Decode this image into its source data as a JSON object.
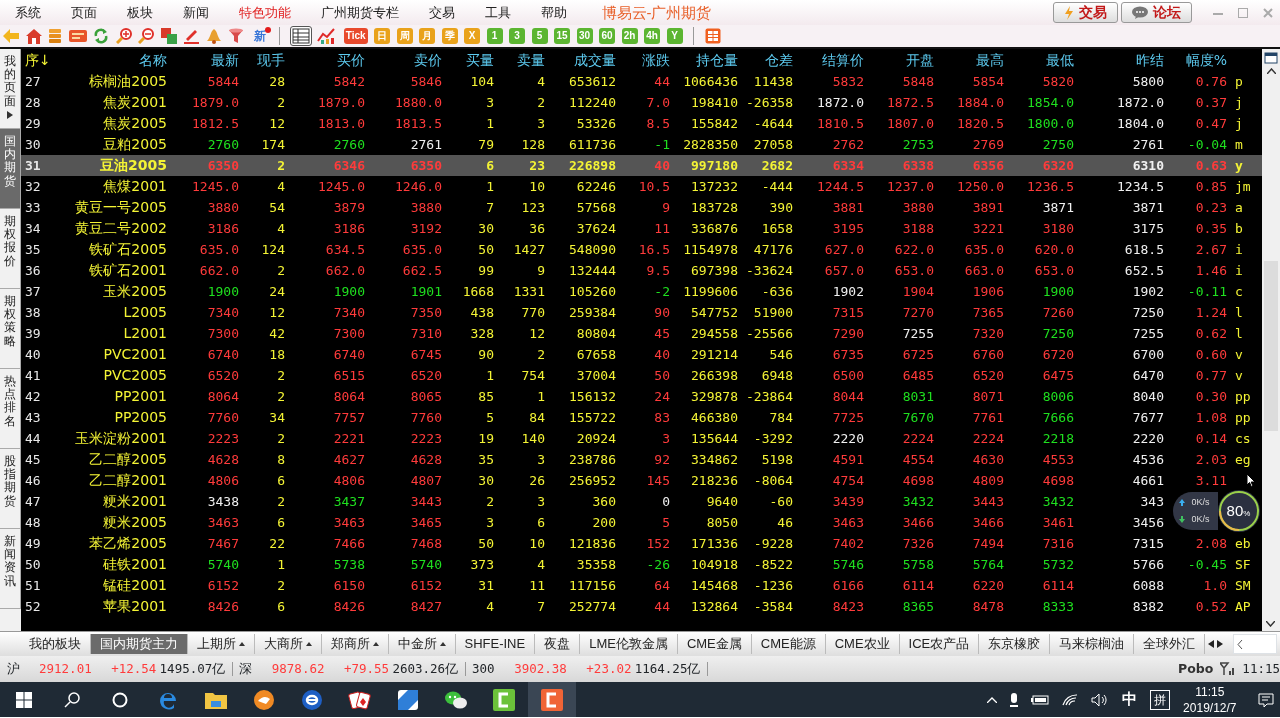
{
  "menu": [
    {
      "label": "系统",
      "active": false
    },
    {
      "label": "页面",
      "active": false
    },
    {
      "label": "板块",
      "active": false
    },
    {
      "label": "新闻",
      "active": false
    },
    {
      "label": "特色功能",
      "active": true
    },
    {
      "label": "广州期货专栏",
      "active": false
    },
    {
      "label": "交易",
      "active": false
    },
    {
      "label": "工具",
      "active": false
    },
    {
      "label": "帮助",
      "active": false
    }
  ],
  "window": {
    "title": "博易云-广州期货"
  },
  "header_buttons": [
    {
      "label": "交易",
      "kind": "trade"
    },
    {
      "label": "论坛",
      "kind": "forum"
    }
  ],
  "toolbar": {
    "news_label": "新",
    "views": [
      {
        "selected": true
      },
      {
        "selected": false
      }
    ],
    "periods": [
      {
        "label": "Tick",
        "color": "#e8492c"
      },
      {
        "label": "日",
        "color": "#e9a21b"
      },
      {
        "label": "周",
        "color": "#e9a21b"
      },
      {
        "label": "月",
        "color": "#e9a21b"
      },
      {
        "label": "季",
        "color": "#e9a21b"
      },
      {
        "label": "X",
        "color": "#e9a21b"
      },
      {
        "label": "1",
        "color": "#5cb531"
      },
      {
        "label": "3",
        "color": "#5cb531"
      },
      {
        "label": "5",
        "color": "#5cb531"
      },
      {
        "label": "15",
        "color": "#5cb531"
      },
      {
        "label": "30",
        "color": "#5cb531"
      },
      {
        "label": "60",
        "color": "#5cb531"
      },
      {
        "label": "2h",
        "color": "#5cb531"
      },
      {
        "label": "4h",
        "color": "#5cb531"
      },
      {
        "label": "Y",
        "color": "#5cb531"
      }
    ]
  },
  "sidebar": [
    {
      "label": "我的页面",
      "selected": false,
      "has_menu": true
    },
    {
      "label": "国内期货",
      "selected": true,
      "has_menu": false
    },
    {
      "label": "期权报价",
      "selected": false,
      "has_menu": false
    },
    {
      "label": "期权策略",
      "selected": false,
      "has_menu": false
    },
    {
      "label": "热点排名",
      "selected": false,
      "has_menu": false
    },
    {
      "label": "股指期货",
      "selected": false,
      "has_menu": false
    },
    {
      "label": "新闻资讯",
      "selected": false,
      "has_menu": false
    }
  ],
  "table": {
    "columns": [
      {
        "label": "序↓",
        "kind": "index"
      },
      {
        "label": "名称",
        "kind": "name"
      },
      {
        "label": "最新",
        "kind": "trend"
      },
      {
        "label": "现手",
        "kind": "volume"
      },
      {
        "label": "买价",
        "kind": "trend"
      },
      {
        "label": "卖价",
        "kind": "trend"
      },
      {
        "label": "买量",
        "kind": "volume"
      },
      {
        "label": "卖量",
        "kind": "volume"
      },
      {
        "label": "成交量",
        "kind": "volume"
      },
      {
        "label": "涨跌",
        "kind": "trend"
      },
      {
        "label": "持仓量",
        "kind": "volume"
      },
      {
        "label": "仓差",
        "kind": "volume"
      },
      {
        "label": "结算价",
        "kind": "trend"
      },
      {
        "label": "开盘",
        "kind": "trend"
      },
      {
        "label": "最高",
        "kind": "trend"
      },
      {
        "label": "最低",
        "kind": "trend"
      },
      {
        "label": "昨结",
        "kind": "plain"
      },
      {
        "label": "幅度%",
        "kind": "trend"
      },
      {
        "kind": "code"
      }
    ],
    "rows": [
      {
        "selected": false,
        "cells": [
          "27",
          "棕榈油2005",
          {
            "text": "5844",
            "color": "#ff3b3b"
          },
          "28",
          {
            "text": "5842",
            "color": "#ff3b3b"
          },
          {
            "text": "5846",
            "color": "#ff3b3b"
          },
          "104",
          "4",
          "653612",
          {
            "text": "44",
            "color": "#ff3b3b"
          },
          "1066436",
          "11438",
          {
            "text": "5832",
            "color": "#ff3b3b"
          },
          {
            "text": "5848",
            "color": "#ff3b3b"
          },
          {
            "text": "5854",
            "color": "#ff3b3b"
          },
          {
            "text": "5820",
            "color": "#ff3b3b"
          },
          "5800",
          {
            "text": "0.76",
            "color": "#ff3b3b"
          },
          "p"
        ]
      },
      {
        "selected": false,
        "cells": [
          "28",
          "焦炭2001",
          {
            "text": "1879.0",
            "color": "#ff3b3b"
          },
          "2",
          {
            "text": "1879.0",
            "color": "#ff3b3b"
          },
          {
            "text": "1880.0",
            "color": "#ff3b3b"
          },
          "3",
          "2",
          "112240",
          {
            "text": "7.0",
            "color": "#ff3b3b"
          },
          "198410",
          "-26358",
          {
            "text": "1872.0",
            "color": "#f0f0f0"
          },
          {
            "text": "1872.5",
            "color": "#ff3b3b"
          },
          {
            "text": "1884.0",
            "color": "#ff3b3b"
          },
          {
            "text": "1854.0",
            "color": "#1fe01f"
          },
          "1872.0",
          {
            "text": "0.37",
            "color": "#ff3b3b"
          },
          "j"
        ]
      },
      {
        "selected": false,
        "cells": [
          "29",
          "焦炭2005",
          {
            "text": "1812.5",
            "color": "#ff3b3b"
          },
          "12",
          {
            "text": "1813.0",
            "color": "#ff3b3b"
          },
          {
            "text": "1813.5",
            "color": "#ff3b3b"
          },
          "1",
          "3",
          "53326",
          {
            "text": "8.5",
            "color": "#ff3b3b"
          },
          "155842",
          "-4644",
          {
            "text": "1810.5",
            "color": "#ff3b3b"
          },
          {
            "text": "1807.0",
            "color": "#ff3b3b"
          },
          {
            "text": "1820.5",
            "color": "#ff3b3b"
          },
          {
            "text": "1800.0",
            "color": "#1fe01f"
          },
          "1804.0",
          {
            "text": "0.47",
            "color": "#ff3b3b"
          },
          "j"
        ]
      },
      {
        "selected": false,
        "cells": [
          "30",
          "豆粕2005",
          {
            "text": "2760",
            "color": "#1fe01f"
          },
          "174",
          {
            "text": "2760",
            "color": "#1fe01f"
          },
          {
            "text": "2761",
            "color": "#f0f0f0"
          },
          "79",
          "128",
          "611736",
          {
            "text": "-1",
            "color": "#1fe01f"
          },
          "2828350",
          "27058",
          {
            "text": "2762",
            "color": "#ff3b3b"
          },
          {
            "text": "2753",
            "color": "#1fe01f"
          },
          {
            "text": "2769",
            "color": "#ff3b3b"
          },
          {
            "text": "2750",
            "color": "#1fe01f"
          },
          "2761",
          {
            "text": "-0.04",
            "color": "#1fe01f"
          },
          "m"
        ]
      },
      {
        "selected": true,
        "cells": [
          "31",
          "豆油2005",
          {
            "text": "6350",
            "color": "#ff3b3b"
          },
          "2",
          {
            "text": "6346",
            "color": "#ff3b3b"
          },
          {
            "text": "6350",
            "color": "#ff3b3b"
          },
          "6",
          "23",
          "226898",
          {
            "text": "40",
            "color": "#ff3b3b"
          },
          "997180",
          "2682",
          {
            "text": "6334",
            "color": "#ff3b3b"
          },
          {
            "text": "6338",
            "color": "#ff3b3b"
          },
          {
            "text": "6356",
            "color": "#ff3b3b"
          },
          {
            "text": "6320",
            "color": "#ff3b3b"
          },
          "6310",
          {
            "text": "0.63",
            "color": "#ff3b3b"
          },
          "y"
        ]
      },
      {
        "selected": false,
        "cells": [
          "32",
          "焦煤2001",
          {
            "text": "1245.0",
            "color": "#ff3b3b"
          },
          "4",
          {
            "text": "1245.0",
            "color": "#ff3b3b"
          },
          {
            "text": "1246.0",
            "color": "#ff3b3b"
          },
          "1",
          "10",
          "62246",
          {
            "text": "10.5",
            "color": "#ff3b3b"
          },
          "137232",
          "-444",
          {
            "text": "1244.5",
            "color": "#ff3b3b"
          },
          {
            "text": "1237.0",
            "color": "#ff3b3b"
          },
          {
            "text": "1250.0",
            "color": "#ff3b3b"
          },
          {
            "text": "1236.5",
            "color": "#ff3b3b"
          },
          "1234.5",
          {
            "text": "0.85",
            "color": "#ff3b3b"
          },
          "jm"
        ]
      },
      {
        "selected": false,
        "cells": [
          "33",
          "黄豆一号2005",
          {
            "text": "3880",
            "color": "#ff3b3b"
          },
          "54",
          {
            "text": "3879",
            "color": "#ff3b3b"
          },
          {
            "text": "3880",
            "color": "#ff3b3b"
          },
          "7",
          "123",
          "57568",
          {
            "text": "9",
            "color": "#ff3b3b"
          },
          "183728",
          "390",
          {
            "text": "3881",
            "color": "#ff3b3b"
          },
          {
            "text": "3880",
            "color": "#ff3b3b"
          },
          {
            "text": "3891",
            "color": "#ff3b3b"
          },
          {
            "text": "3871",
            "color": "#f0f0f0"
          },
          "3871",
          {
            "text": "0.23",
            "color": "#ff3b3b"
          },
          "a"
        ]
      },
      {
        "selected": false,
        "cells": [
          "34",
          "黄豆二号2002",
          {
            "text": "3186",
            "color": "#ff3b3b"
          },
          "4",
          {
            "text": "3186",
            "color": "#ff3b3b"
          },
          {
            "text": "3192",
            "color": "#ff3b3b"
          },
          "30",
          "36",
          "37624",
          {
            "text": "11",
            "color": "#ff3b3b"
          },
          "336876",
          "1658",
          {
            "text": "3195",
            "color": "#ff3b3b"
          },
          {
            "text": "3188",
            "color": "#ff3b3b"
          },
          {
            "text": "3221",
            "color": "#ff3b3b"
          },
          {
            "text": "3180",
            "color": "#ff3b3b"
          },
          "3175",
          {
            "text": "0.35",
            "color": "#ff3b3b"
          },
          "b"
        ]
      },
      {
        "selected": false,
        "cells": [
          "35",
          "铁矿石2005",
          {
            "text": "635.0",
            "color": "#ff3b3b"
          },
          "124",
          {
            "text": "634.5",
            "color": "#ff3b3b"
          },
          {
            "text": "635.0",
            "color": "#ff3b3b"
          },
          "50",
          "1427",
          "548090",
          {
            "text": "16.5",
            "color": "#ff3b3b"
          },
          "1154978",
          "47176",
          {
            "text": "627.0",
            "color": "#ff3b3b"
          },
          {
            "text": "622.0",
            "color": "#ff3b3b"
          },
          {
            "text": "635.0",
            "color": "#ff3b3b"
          },
          {
            "text": "620.0",
            "color": "#ff3b3b"
          },
          "618.5",
          {
            "text": "2.67",
            "color": "#ff3b3b"
          },
          "i"
        ]
      },
      {
        "selected": false,
        "cells": [
          "36",
          "铁矿石2001",
          {
            "text": "662.0",
            "color": "#ff3b3b"
          },
          "2",
          {
            "text": "662.0",
            "color": "#ff3b3b"
          },
          {
            "text": "662.5",
            "color": "#ff3b3b"
          },
          "99",
          "9",
          "132444",
          {
            "text": "9.5",
            "color": "#ff3b3b"
          },
          "697398",
          "-33624",
          {
            "text": "657.0",
            "color": "#ff3b3b"
          },
          {
            "text": "653.0",
            "color": "#ff3b3b"
          },
          {
            "text": "663.0",
            "color": "#ff3b3b"
          },
          {
            "text": "653.0",
            "color": "#ff3b3b"
          },
          "652.5",
          {
            "text": "1.46",
            "color": "#ff3b3b"
          },
          "i"
        ]
      },
      {
        "selected": false,
        "cells": [
          "37",
          "玉米2005",
          {
            "text": "1900",
            "color": "#1fe01f"
          },
          "24",
          {
            "text": "1900",
            "color": "#1fe01f"
          },
          {
            "text": "1901",
            "color": "#1fe01f"
          },
          "1668",
          "1331",
          "105260",
          {
            "text": "-2",
            "color": "#1fe01f"
          },
          "1199606",
          "-636",
          {
            "text": "1902",
            "color": "#f0f0f0"
          },
          {
            "text": "1904",
            "color": "#ff3b3b"
          },
          {
            "text": "1906",
            "color": "#ff3b3b"
          },
          {
            "text": "1900",
            "color": "#1fe01f"
          },
          "1902",
          {
            "text": "-0.11",
            "color": "#1fe01f"
          },
          "c"
        ]
      },
      {
        "selected": false,
        "cells": [
          "38",
          "L2005",
          {
            "text": "7340",
            "color": "#ff3b3b"
          },
          "12",
          {
            "text": "7340",
            "color": "#ff3b3b"
          },
          {
            "text": "7350",
            "color": "#ff3b3b"
          },
          "438",
          "770",
          "259384",
          {
            "text": "90",
            "color": "#ff3b3b"
          },
          "547752",
          "51900",
          {
            "text": "7315",
            "color": "#ff3b3b"
          },
          {
            "text": "7270",
            "color": "#ff3b3b"
          },
          {
            "text": "7365",
            "color": "#ff3b3b"
          },
          {
            "text": "7260",
            "color": "#ff3b3b"
          },
          "7250",
          {
            "text": "1.24",
            "color": "#ff3b3b"
          },
          "l"
        ]
      },
      {
        "selected": false,
        "cells": [
          "39",
          "L2001",
          {
            "text": "7300",
            "color": "#ff3b3b"
          },
          "42",
          {
            "text": "7300",
            "color": "#ff3b3b"
          },
          {
            "text": "7310",
            "color": "#ff3b3b"
          },
          "328",
          "12",
          "80804",
          {
            "text": "45",
            "color": "#ff3b3b"
          },
          "294558",
          "-25566",
          {
            "text": "7290",
            "color": "#ff3b3b"
          },
          {
            "text": "7255",
            "color": "#f0f0f0"
          },
          {
            "text": "7320",
            "color": "#ff3b3b"
          },
          {
            "text": "7250",
            "color": "#1fe01f"
          },
          "7255",
          {
            "text": "0.62",
            "color": "#ff3b3b"
          },
          "l"
        ]
      },
      {
        "selected": false,
        "cells": [
          "40",
          "PVC2001",
          {
            "text": "6740",
            "color": "#ff3b3b"
          },
          "18",
          {
            "text": "6740",
            "color": "#ff3b3b"
          },
          {
            "text": "6745",
            "color": "#ff3b3b"
          },
          "90",
          "2",
          "67658",
          {
            "text": "40",
            "color": "#ff3b3b"
          },
          "291214",
          "546",
          {
            "text": "6735",
            "color": "#ff3b3b"
          },
          {
            "text": "6725",
            "color": "#ff3b3b"
          },
          {
            "text": "6760",
            "color": "#ff3b3b"
          },
          {
            "text": "6720",
            "color": "#ff3b3b"
          },
          "6700",
          {
            "text": "0.60",
            "color": "#ff3b3b"
          },
          "v"
        ]
      },
      {
        "selected": false,
        "cells": [
          "41",
          "PVC2005",
          {
            "text": "6520",
            "color": "#ff3b3b"
          },
          "2",
          {
            "text": "6515",
            "color": "#ff3b3b"
          },
          {
            "text": "6520",
            "color": "#ff3b3b"
          },
          "1",
          "754",
          "37004",
          {
            "text": "50",
            "color": "#ff3b3b"
          },
          "266398",
          "6948",
          {
            "text": "6500",
            "color": "#ff3b3b"
          },
          {
            "text": "6485",
            "color": "#ff3b3b"
          },
          {
            "text": "6520",
            "color": "#ff3b3b"
          },
          {
            "text": "6475",
            "color": "#ff3b3b"
          },
          "6470",
          {
            "text": "0.77",
            "color": "#ff3b3b"
          },
          "v"
        ]
      },
      {
        "selected": false,
        "cells": [
          "42",
          "PP2001",
          {
            "text": "8064",
            "color": "#ff3b3b"
          },
          "2",
          {
            "text": "8064",
            "color": "#ff3b3b"
          },
          {
            "text": "8065",
            "color": "#ff3b3b"
          },
          "85",
          "1",
          "156132",
          {
            "text": "24",
            "color": "#ff3b3b"
          },
          "329878",
          "-23864",
          {
            "text": "8044",
            "color": "#ff3b3b"
          },
          {
            "text": "8031",
            "color": "#1fe01f"
          },
          {
            "text": "8071",
            "color": "#ff3b3b"
          },
          {
            "text": "8006",
            "color": "#1fe01f"
          },
          "8040",
          {
            "text": "0.30",
            "color": "#ff3b3b"
          },
          "pp"
        ]
      },
      {
        "selected": false,
        "cells": [
          "43",
          "PP2005",
          {
            "text": "7760",
            "color": "#ff3b3b"
          },
          "34",
          {
            "text": "7757",
            "color": "#ff3b3b"
          },
          {
            "text": "7760",
            "color": "#ff3b3b"
          },
          "5",
          "84",
          "155722",
          {
            "text": "83",
            "color": "#ff3b3b"
          },
          "466380",
          "784",
          {
            "text": "7725",
            "color": "#ff3b3b"
          },
          {
            "text": "7670",
            "color": "#1fe01f"
          },
          {
            "text": "7761",
            "color": "#ff3b3b"
          },
          {
            "text": "7666",
            "color": "#1fe01f"
          },
          "7677",
          {
            "text": "1.08",
            "color": "#ff3b3b"
          },
          "pp"
        ]
      },
      {
        "selected": false,
        "cells": [
          "44",
          "玉米淀粉2001",
          {
            "text": "2223",
            "color": "#ff3b3b"
          },
          "2",
          {
            "text": "2221",
            "color": "#ff3b3b"
          },
          {
            "text": "2223",
            "color": "#ff3b3b"
          },
          "19",
          "140",
          "20924",
          {
            "text": "3",
            "color": "#ff3b3b"
          },
          "135644",
          "-3292",
          {
            "text": "2220",
            "color": "#f0f0f0"
          },
          {
            "text": "2224",
            "color": "#ff3b3b"
          },
          {
            "text": "2224",
            "color": "#ff3b3b"
          },
          {
            "text": "2218",
            "color": "#1fe01f"
          },
          "2220",
          {
            "text": "0.14",
            "color": "#ff3b3b"
          },
          "cs"
        ]
      },
      {
        "selected": false,
        "cells": [
          "45",
          "乙二醇2005",
          {
            "text": "4628",
            "color": "#ff3b3b"
          },
          "8",
          {
            "text": "4627",
            "color": "#ff3b3b"
          },
          {
            "text": "4628",
            "color": "#ff3b3b"
          },
          "35",
          "3",
          "238786",
          {
            "text": "92",
            "color": "#ff3b3b"
          },
          "334862",
          "5198",
          {
            "text": "4591",
            "color": "#ff3b3b"
          },
          {
            "text": "4554",
            "color": "#ff3b3b"
          },
          {
            "text": "4630",
            "color": "#ff3b3b"
          },
          {
            "text": "4553",
            "color": "#ff3b3b"
          },
          "4536",
          {
            "text": "2.03",
            "color": "#ff3b3b"
          },
          "eg"
        ]
      },
      {
        "selected": false,
        "cells": [
          "46",
          "乙二醇2001",
          {
            "text": "4806",
            "color": "#ff3b3b"
          },
          "6",
          {
            "text": "4806",
            "color": "#ff3b3b"
          },
          {
            "text": "4807",
            "color": "#ff3b3b"
          },
          "30",
          "26",
          "256952",
          {
            "text": "145",
            "color": "#ff3b3b"
          },
          "218236",
          "-8064",
          {
            "text": "4754",
            "color": "#ff3b3b"
          },
          {
            "text": "4698",
            "color": "#ff3b3b"
          },
          {
            "text": "4809",
            "color": "#ff3b3b"
          },
          {
            "text": "4698",
            "color": "#ff3b3b"
          },
          "4661",
          {
            "text": "3.11",
            "color": "#ff3b3b"
          },
          null
        ]
      },
      {
        "selected": false,
        "cells": [
          "47",
          "粳米2001",
          {
            "text": "3438",
            "color": "#f0f0f0"
          },
          "2",
          {
            "text": "3437",
            "color": "#1fe01f"
          },
          {
            "text": "3443",
            "color": "#ff3b3b"
          },
          "2",
          "3",
          "360",
          {
            "text": "0",
            "color": "#f0f0f0"
          },
          "9640",
          "-60",
          {
            "text": "3439",
            "color": "#ff3b3b"
          },
          {
            "text": "3432",
            "color": "#1fe01f"
          },
          {
            "text": "3443",
            "color": "#ff3b3b"
          },
          {
            "text": "3432",
            "color": "#1fe01f"
          },
          "343",
          null,
          null
        ]
      },
      {
        "selected": false,
        "cells": [
          "48",
          "粳米2005",
          {
            "text": "3463",
            "color": "#ff3b3b"
          },
          "6",
          {
            "text": "3463",
            "color": "#ff3b3b"
          },
          {
            "text": "3465",
            "color": "#ff3b3b"
          },
          "3",
          "6",
          "200",
          {
            "text": "5",
            "color": "#ff3b3b"
          },
          "8050",
          "46",
          {
            "text": "3463",
            "color": "#ff3b3b"
          },
          {
            "text": "3466",
            "color": "#ff3b3b"
          },
          {
            "text": "3466",
            "color": "#ff3b3b"
          },
          {
            "text": "3461",
            "color": "#ff3b3b"
          },
          "3456",
          null,
          null
        ]
      },
      {
        "selected": false,
        "cells": [
          "49",
          "苯乙烯2005",
          {
            "text": "7467",
            "color": "#ff3b3b"
          },
          "22",
          {
            "text": "7466",
            "color": "#ff3b3b"
          },
          {
            "text": "7468",
            "color": "#ff3b3b"
          },
          "50",
          "10",
          "121836",
          {
            "text": "152",
            "color": "#ff3b3b"
          },
          "171336",
          "-9228",
          {
            "text": "7402",
            "color": "#ff3b3b"
          },
          {
            "text": "7326",
            "color": "#ff3b3b"
          },
          {
            "text": "7494",
            "color": "#ff3b3b"
          },
          {
            "text": "7316",
            "color": "#ff3b3b"
          },
          "7315",
          {
            "text": "2.08",
            "color": "#ff3b3b"
          },
          "eb"
        ]
      },
      {
        "selected": false,
        "cells": [
          "50",
          "硅铁2001",
          {
            "text": "5740",
            "color": "#1fe01f"
          },
          "1",
          {
            "text": "5738",
            "color": "#1fe01f"
          },
          {
            "text": "5740",
            "color": "#1fe01f"
          },
          "373",
          "4",
          "35358",
          {
            "text": "-26",
            "color": "#1fe01f"
          },
          "104918",
          "-8522",
          {
            "text": "5746",
            "color": "#1fe01f"
          },
          {
            "text": "5758",
            "color": "#1fe01f"
          },
          {
            "text": "5764",
            "color": "#1fe01f"
          },
          {
            "text": "5732",
            "color": "#1fe01f"
          },
          "5766",
          {
            "text": "-0.45",
            "color": "#1fe01f"
          },
          "SF"
        ]
      },
      {
        "selected": false,
        "cells": [
          "51",
          "锰硅2001",
          {
            "text": "6152",
            "color": "#ff3b3b"
          },
          "2",
          {
            "text": "6150",
            "color": "#ff3b3b"
          },
          {
            "text": "6152",
            "color": "#ff3b3b"
          },
          "31",
          "11",
          "117156",
          {
            "text": "64",
            "color": "#ff3b3b"
          },
          "145468",
          "-1236",
          {
            "text": "6166",
            "color": "#ff3b3b"
          },
          {
            "text": "6114",
            "color": "#ff3b3b"
          },
          {
            "text": "6220",
            "color": "#ff3b3b"
          },
          {
            "text": "6114",
            "color": "#ff3b3b"
          },
          "6088",
          {
            "text": "1.0",
            "color": "#ff3b3b"
          },
          "SM"
        ]
      },
      {
        "selected": false,
        "cells": [
          "52",
          "苹果2001",
          {
            "text": "8426",
            "color": "#ff3b3b"
          },
          "6",
          {
            "text": "8426",
            "color": "#ff3b3b"
          },
          {
            "text": "8427",
            "color": "#ff3b3b"
          },
          "4",
          "7",
          "252774",
          {
            "text": "44",
            "color": "#ff3b3b"
          },
          "132864",
          "-3584",
          {
            "text": "8423",
            "color": "#ff3b3b"
          },
          {
            "text": "8365",
            "color": "#1fe01f"
          },
          {
            "text": "8478",
            "color": "#ff3b3b"
          },
          {
            "text": "8333",
            "color": "#1fe01f"
          },
          "8382",
          {
            "text": "0.52",
            "color": "#ff3b3b"
          },
          "AP"
        ]
      }
    ]
  },
  "net_widget": {
    "upload": "0K/s",
    "download": "0K/s",
    "percent": "80",
    "unit": "%"
  },
  "bottom_tabs": [
    {
      "label": "我的板块",
      "selected": false,
      "has_menu": false
    },
    {
      "label": "国内期货主力",
      "selected": true,
      "has_menu": false
    },
    {
      "label": "上期所",
      "selected": false,
      "has_menu": true
    },
    {
      "label": "大商所",
      "selected": false,
      "has_menu": true
    },
    {
      "label": "郑商所",
      "selected": false,
      "has_menu": true
    },
    {
      "label": "中金所",
      "selected": false,
      "has_menu": true
    },
    {
      "label": "SHFE-INE",
      "selected": false,
      "has_menu": false
    },
    {
      "label": "夜盘",
      "selected": false,
      "has_menu": false
    },
    {
      "label": "LME伦敦金属",
      "selected": false,
      "has_menu": false
    },
    {
      "label": "CME金属",
      "selected": false,
      "has_menu": false
    },
    {
      "label": "CME能源",
      "selected": false,
      "has_menu": false
    },
    {
      "label": "CME农业",
      "selected": false,
      "has_menu": false
    },
    {
      "label": "ICE农产品",
      "selected": false,
      "has_menu": false
    },
    {
      "label": "东京橡胶",
      "selected": false,
      "has_menu": false
    },
    {
      "label": "马来棕榈油",
      "selected": false,
      "has_menu": false
    },
    {
      "label": "全球外汇",
      "selected": false,
      "has_menu": false
    }
  ],
  "status_bar": {
    "indices": [
      {
        "label": "沪",
        "value": "2912.01",
        "change": "+12.54",
        "amount": "1495.07亿",
        "color": "#ff3b3b"
      },
      {
        "label": "深",
        "value": "9878.62",
        "change": "+79.55",
        "amount": "2603.26亿",
        "color": "#ff3b3b"
      },
      {
        "label": "300",
        "value": "3902.38",
        "change": "+23.02",
        "amount": "1164.25亿",
        "color": "#ff3b3b"
      }
    ],
    "brand": "Pobo",
    "time": "11:15"
  },
  "taskbar": {
    "ime": "中",
    "ime_mode": "拼",
    "time": "11:15",
    "date": "2019/12/7"
  }
}
